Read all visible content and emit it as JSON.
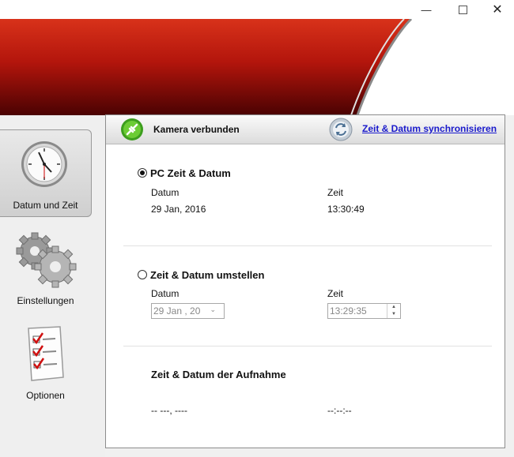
{
  "window": {
    "minimize_glyph": "—",
    "close_glyph": "✕"
  },
  "sidebar": {
    "items": [
      {
        "label": "Datum und Zeit",
        "icon": "clock-icon",
        "active": true
      },
      {
        "label": "Einstellungen",
        "icon": "gears-icon",
        "active": false
      },
      {
        "label": "Optionen",
        "icon": "checklist-icon",
        "active": false
      }
    ]
  },
  "header": {
    "status_label": "Kamera verbunden",
    "status_icon": "camera-connected-icon",
    "sync_link": "Zeit & Datum synchronisieren",
    "sync_icon": "sync-icon"
  },
  "pc_time": {
    "title": "PC Zeit & Datum",
    "selected": true,
    "date_label": "Datum",
    "time_label": "Zeit",
    "date_value": "29 Jan, 2016",
    "time_value": "13:30:49"
  },
  "set_time": {
    "title": "Zeit & Datum umstellen",
    "selected": false,
    "date_label": "Datum",
    "time_label": "Zeit",
    "date_input": "29 Jan , 20",
    "time_input": "13:29:35"
  },
  "capture_time": {
    "title": "Zeit & Datum der Aufnahme",
    "date_value": "-- ---, ----",
    "time_value": "--:--:--"
  },
  "colors": {
    "banner_red": "#c8200f",
    "banner_dark": "#5a0303",
    "link_blue": "#1a1acc"
  }
}
